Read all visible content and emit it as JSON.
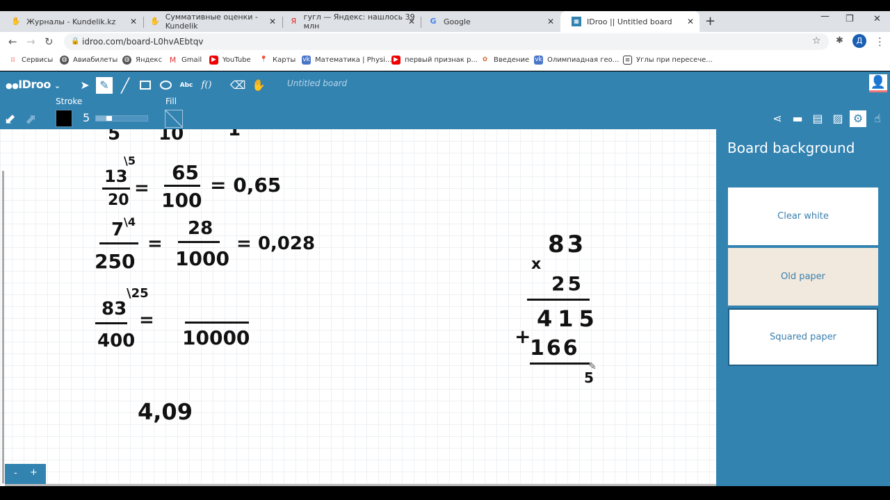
{
  "browser": {
    "tabs": [
      {
        "title": "Журналы - Kundelik.kz"
      },
      {
        "title": "Суммативные оценки - Kundelik"
      },
      {
        "title": "гугл — Яндекс: нашлось 39 млн"
      },
      {
        "title": "Google"
      },
      {
        "title": "IDroo || Untitled board"
      }
    ],
    "url": "idroo.com/board-L0hvAEbtqv",
    "profile_initial": "Д",
    "bookmarks": [
      "Сервисы",
      "Авиабилеты",
      "Яндекс",
      "Gmail",
      "YouTube",
      "Карты",
      "Математика | Physi...",
      "первый признак р...",
      "Введение",
      "Олимпиадная гео...",
      "Углы при пересече..."
    ]
  },
  "app": {
    "logo": "IDroo",
    "board_title": "Untitled board",
    "text_tool": "Abc",
    "formula_tool": "f()",
    "stroke_label": "Stroke",
    "stroke_color": "#000000",
    "stroke_width": "5",
    "stroke_slider_fraction": 0.25,
    "fill_label": "Fill",
    "accent": "#3383b1"
  },
  "sidebar": {
    "title": "Board background",
    "options": [
      "Clear white",
      "Old paper",
      "Squared paper"
    ],
    "selected": "Squared paper"
  },
  "zoom": {
    "minus": "-",
    "plus": "+"
  },
  "board": {
    "top_partial": [
      "5",
      "10",
      "1"
    ],
    "f1": {
      "num": "13",
      "factor": "\\5",
      "den": "20",
      "eq": "=",
      "num2": "65",
      "den2": "100",
      "result": "= 0,65"
    },
    "f2": {
      "num": "7",
      "factor": "\\4",
      "den": "250",
      "eq": "=",
      "num2": "28",
      "den2": "1000",
      "result": "= 0,028"
    },
    "f3": {
      "num": "83",
      "factor": "\\25",
      "den": "400",
      "eq": "=",
      "den2": "10000"
    },
    "decimal": "4,09",
    "mult": {
      "times": "x",
      "a": "83",
      "b": "25",
      "p1": "415",
      "plus": "+",
      "p2": "166",
      "r": "5"
    }
  }
}
